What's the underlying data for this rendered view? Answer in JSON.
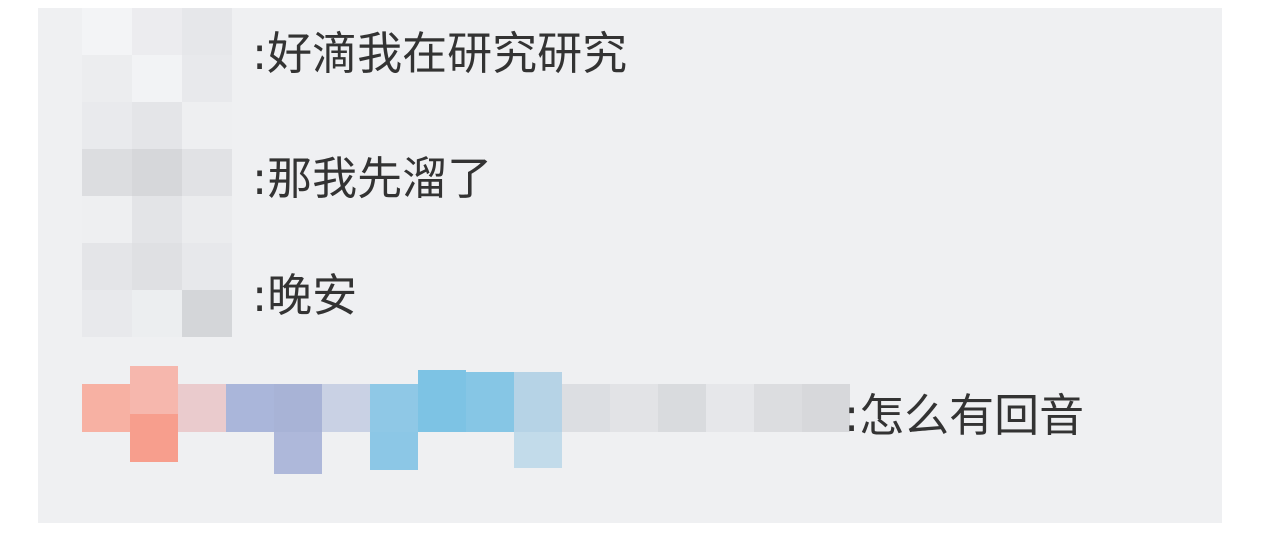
{
  "chat": {
    "messages": [
      {
        "text": ":好滴我在研究研究"
      },
      {
        "text": ":那我先溜了"
      },
      {
        "text": ":晚安"
      },
      {
        "text": ":怎么有回音"
      }
    ]
  },
  "colors": {
    "panel_bg": "#eff0f2",
    "text": "#333333"
  },
  "icons": {
    "avatar_redacted": "pixelated-avatar",
    "name_redacted": "pixelated-username"
  }
}
